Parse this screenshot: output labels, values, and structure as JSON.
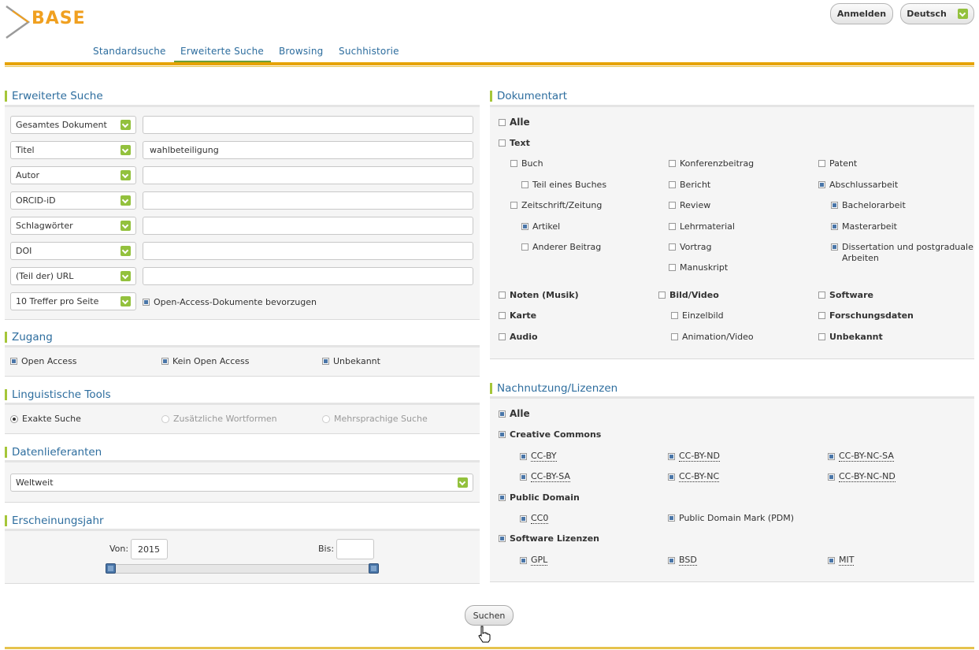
{
  "logo": {
    "text": "BASE"
  },
  "top": {
    "login": "Anmelden",
    "language": "Deutsch"
  },
  "nav": [
    "Standardsuche",
    "Erweiterte Suche",
    "Browsing",
    "Suchhistorie"
  ],
  "adv": {
    "title": "Erweiterte Suche",
    "rows": [
      {
        "field": "Gesamtes Dokument",
        "value": ""
      },
      {
        "field": "Titel",
        "value": "wahlbeteiligung"
      },
      {
        "field": "Autor",
        "value": ""
      },
      {
        "field": "ORCID-iD",
        "value": ""
      },
      {
        "field": "Schlagwörter",
        "value": ""
      },
      {
        "field": "DOI",
        "value": ""
      },
      {
        "field": "(Teil der) URL",
        "value": ""
      }
    ],
    "hits": "10 Treffer pro Seite",
    "oa_pref": "Open-Access-Dokumente bevorzugen"
  },
  "zugang": {
    "title": "Zugang",
    "items": [
      "Open Access",
      "Kein Open Access",
      "Unbekannt"
    ]
  },
  "ling": {
    "title": "Linguistische Tools",
    "items": [
      "Exakte Suche",
      "Zusätzliche Wortformen",
      "Mehrsprachige Suche"
    ]
  },
  "daten": {
    "title": "Datenlieferanten",
    "value": "Weltweit"
  },
  "jahr": {
    "title": "Erscheinungsjahr",
    "von_label": "Von:",
    "von": "2015",
    "bis_label": "Bis:",
    "bis": ""
  },
  "dok": {
    "title": "Dokumentart",
    "alle": "Alle",
    "text": "Text",
    "buch": "Buch",
    "teil": "Teil eines Buches",
    "zeit": "Zeitschrift/Zeitung",
    "artikel": "Artikel",
    "anderer": "Anderer Beitrag",
    "konf": "Konferenzbeitrag",
    "bericht": "Bericht",
    "review": "Review",
    "lehr": "Lehrmaterial",
    "vortrag": "Vortrag",
    "manu": "Manuskript",
    "patent": "Patent",
    "absch": "Abschlussarbeit",
    "bach": "Bachelorarbeit",
    "master": "Masterarbeit",
    "diss1": "Dissertation und postgraduale",
    "diss2": "Arbeiten",
    "noten": "Noten (Musik)",
    "karte": "Karte",
    "audio": "Audio",
    "bild": "Bild/Video",
    "einzel": "Einzelbild",
    "anim": "Animation/Video",
    "soft": "Software",
    "forsch": "Forschungsdaten",
    "unbek": "Unbekannt"
  },
  "lic": {
    "title": "Nachnutzung/Lizenzen",
    "alle": "Alle",
    "cc": "Creative Commons",
    "ccby": "CC-BY",
    "ccbynd": "CC-BY-ND",
    "ccbyncsa": "CC-BY-NC-SA",
    "ccbysa": "CC-BY-SA",
    "ccbync": "CC-BY-NC",
    "ccbyncnd": "CC-BY-NC-ND",
    "pd": "Public Domain",
    "cc0": "CC0",
    "pdm": "Public Domain Mark (PDM)",
    "sw": "Software Lizenzen",
    "gpl": "GPL",
    "bsd": "BSD",
    "mit": "MIT"
  },
  "search_btn": "Suchen",
  "colors": {
    "accent": "#2d6d9e",
    "gold": "#e6a300",
    "green": "#93c13d"
  }
}
